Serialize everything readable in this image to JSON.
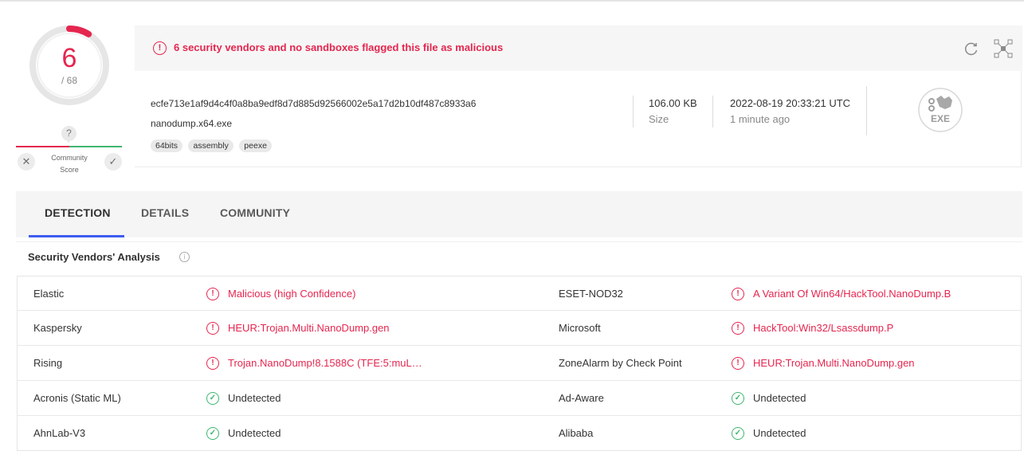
{
  "colors": {
    "malicious": "#e5264f",
    "clean": "#3fb670",
    "accent": "#3e5cf1"
  },
  "score": {
    "positives": "6",
    "total": "/ 68",
    "ratio": 0.088
  },
  "community": {
    "question": "?",
    "label_line1": "Community",
    "label_line2": "Score",
    "down_icon": "close-icon",
    "up_icon": "check-icon"
  },
  "alert": {
    "icon": "!",
    "text": "6 security vendors and no sandboxes flagged this file as malicious"
  },
  "file": {
    "hash": "ecfe713e1af9d4c4f0a8ba9edf8d7d885d92566002e5a17d2b10df487c8933a6",
    "name": "nanodump.x64.exe",
    "tags": [
      "64bits",
      "assembly",
      "peexe"
    ],
    "size_value": "106.00 KB",
    "size_label": "Size",
    "date_value": "2022-08-19 20:33:21 UTC",
    "date_relative": "1 minute ago",
    "type_label": "EXE"
  },
  "tabs": [
    {
      "label": "DETECTION",
      "active": true
    },
    {
      "label": "DETAILS",
      "active": false
    },
    {
      "label": "COMMUNITY",
      "active": false
    }
  ],
  "section": {
    "title": "Security Vendors' Analysis",
    "info_icon": "i"
  },
  "rows": [
    {
      "v1": "Elastic",
      "r1": "Malicious (high Confidence)",
      "s1": "malicious",
      "v2": "ESET-NOD32",
      "r2": "A Variant Of Win64/HackTool.NanoDump.B",
      "s2": "malicious"
    },
    {
      "v1": "Kaspersky",
      "r1": "HEUR:Trojan.Multi.NanoDump.gen",
      "s1": "malicious",
      "v2": "Microsoft",
      "r2": "HackTool:Win32/Lsassdump.P",
      "s2": "malicious"
    },
    {
      "v1": "Rising",
      "r1": "Trojan.NanoDump!8.1588C (TFE:5:muL…",
      "s1": "malicious",
      "v2": "ZoneAlarm by Check Point",
      "r2": "HEUR:Trojan.Multi.NanoDump.gen",
      "s2": "malicious"
    },
    {
      "v1": "Acronis (Static ML)",
      "r1": "Undetected",
      "s1": "undetected",
      "v2": "Ad-Aware",
      "r2": "Undetected",
      "s2": "undetected"
    },
    {
      "v1": "AhnLab-V3",
      "r1": "Undetected",
      "s1": "undetected",
      "v2": "Alibaba",
      "r2": "Undetected",
      "s2": "undetected"
    }
  ]
}
